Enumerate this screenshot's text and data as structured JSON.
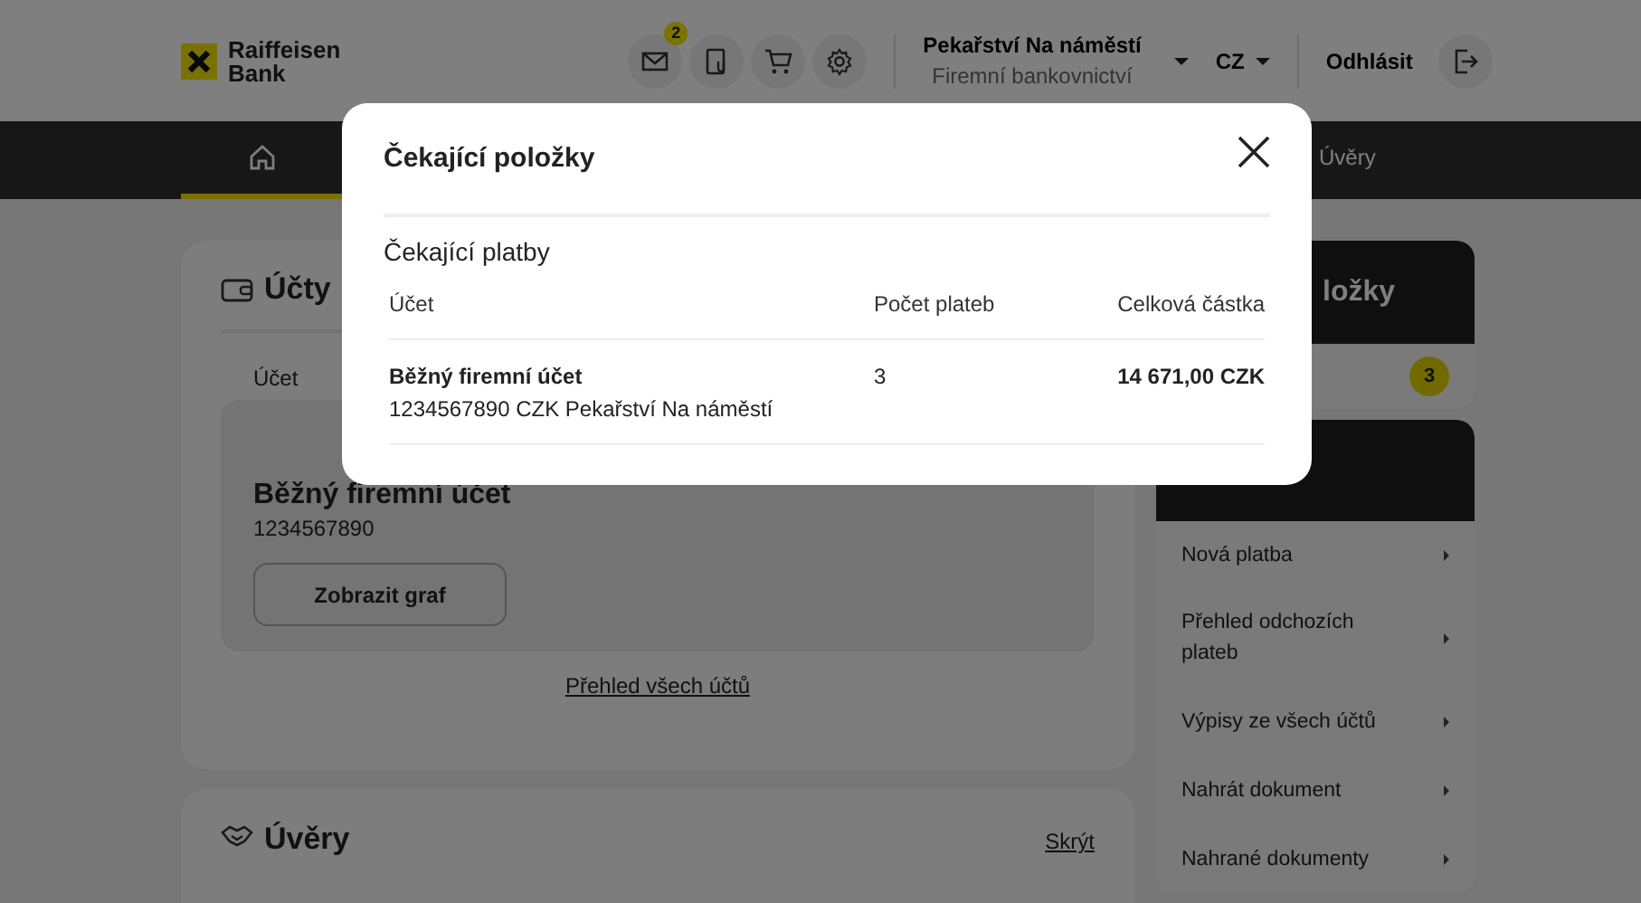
{
  "header": {
    "logo_lines": [
      "Raiffeisen",
      "Bank"
    ],
    "mail_badge": "2",
    "company": "Pekařství Na náměstí",
    "segment": "Firemní bankovnictví",
    "language": "CZ",
    "logout": "Odhlásit"
  },
  "nav": {
    "items": [
      {
        "kind": "home",
        "selected": true
      },
      {
        "kind": "text",
        "label": "Úvěry",
        "selected": false
      }
    ]
  },
  "accounts_card": {
    "title": "Účty",
    "column_label": "Účet",
    "account": {
      "name": "Běžný firemní účet",
      "number": "1234567890"
    },
    "chart_button": "Zobrazit graf",
    "all_link": "Přehled všech účtů"
  },
  "loans_card": {
    "title": "Úvěry",
    "toggle": "Skrýt"
  },
  "pending_card": {
    "title_visible": "ložky",
    "count": "3"
  },
  "quick_actions": {
    "items": [
      "Nová platba",
      "Přehled odchozích plateb",
      "Výpisy ze všech účtů",
      "Nahrát dokument",
      "Nahrané dokumenty"
    ]
  },
  "modal": {
    "title": "Čekající položky",
    "section": "Čekající platby",
    "columns": [
      "Účet",
      "Počet plateb",
      "Celková částka"
    ],
    "rows": [
      {
        "account": "Běžný firemní účet",
        "detail": "1234567890 CZK Pekařství Na náměstí",
        "count": "3",
        "total": "14 671,00 CZK"
      }
    ]
  }
}
